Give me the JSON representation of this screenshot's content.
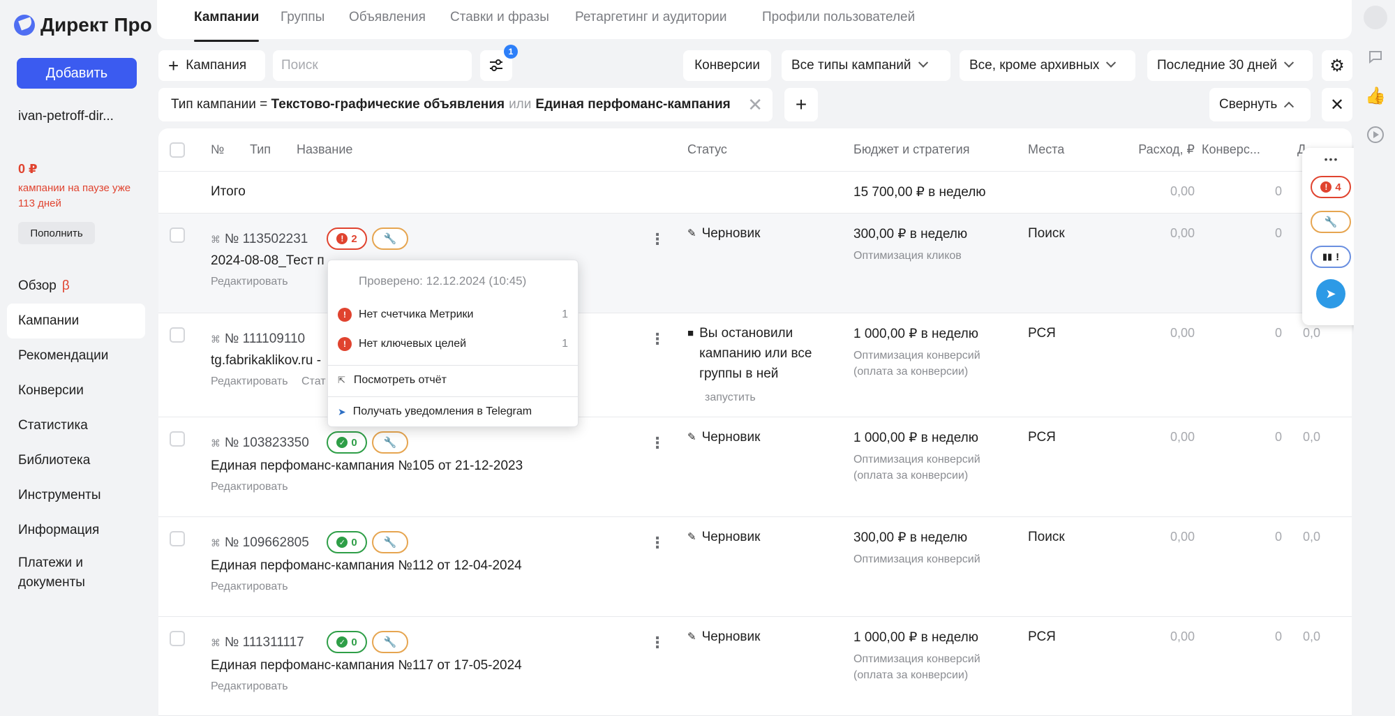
{
  "app": {
    "logo_text": "Директ Про"
  },
  "sidebar": {
    "add_label": "Добавить",
    "account": "ivan-petroff-dir...",
    "balance": "0 ₽",
    "pause_note": "кампании на паузе уже 113 дней",
    "topup_label": "Пополнить",
    "items": [
      {
        "label": "Обзор",
        "badge": "β"
      },
      {
        "label": "Кампании"
      },
      {
        "label": "Рекомендации"
      },
      {
        "label": "Конверсии"
      },
      {
        "label": "Статистика"
      },
      {
        "label": "Библиотека"
      },
      {
        "label": "Инструменты"
      },
      {
        "label": "Информация"
      },
      {
        "label": "Платежи и документы"
      }
    ]
  },
  "tabs": [
    {
      "label": "Кампании",
      "active": true
    },
    {
      "label": "Группы"
    },
    {
      "label": "Объявления"
    },
    {
      "label": "Ставки и фразы"
    },
    {
      "label": "Ретаргетинг и аудитории"
    },
    {
      "label": "Профили пользователей"
    }
  ],
  "toolbar": {
    "add_campaign": "Кампания",
    "search_placeholder": "Поиск",
    "filter_badge": "1",
    "conversions": "Конверсии",
    "campaign_types": "Все типы кампаний",
    "archive_filter": "Все, кроме архивных",
    "period": "Последние 30 дней"
  },
  "filter_chip": {
    "prefix": "Тип кампании = ",
    "value1": "Текстово-графические объявления",
    "or": "или",
    "value2": "Единая перфоманс-кампания"
  },
  "collapse_label": "Свернуть",
  "table": {
    "headers": {
      "no": "№",
      "type": "Тип",
      "name": "Название",
      "status": "Статус",
      "budget": "Бюджет и стратегия",
      "places": "Места",
      "spend": "Расход, ₽",
      "conv": "Конверс...",
      "extra": "Д"
    },
    "total": {
      "label": "Итого",
      "budget": "15 700,00 ₽ в неделю",
      "spend": "0,00",
      "conv": "0"
    },
    "rows": [
      {
        "id": "№ 113502231",
        "badge": "2",
        "badge_kind": "red",
        "name": "2024-08-08_Тест п",
        "edit": "Редактировать",
        "stats": "",
        "status": "Черновик",
        "status_icon": "pencil",
        "status_sub": "",
        "budget": "300,00 ₽ в неделю",
        "strategy": "Оптимизация кликов",
        "places": "Поиск",
        "spend": "0,00",
        "conv": "0",
        "extra": ""
      },
      {
        "id": "№ 111109110",
        "badge": "",
        "badge_kind": "none",
        "name": "tg.fabrikaklikov.ru -",
        "edit": "Редактировать",
        "stats": "Стат",
        "status": "Вы остановили кампанию или все группы в ней",
        "status_icon": "square",
        "status_sub": "запустить",
        "budget": "1 000,00 ₽ в неделю",
        "strategy": "Оптимизация конверсий (оплата за конверсии)",
        "places": "РСЯ",
        "spend": "0,00",
        "conv": "0",
        "extra": "0,0"
      },
      {
        "id": "№ 103823350",
        "badge": "0",
        "badge_kind": "green",
        "name": "Единая перфоманс-кампания №105 от 21-12-2023",
        "edit": "Редактировать",
        "stats": "",
        "status": "Черновик",
        "status_icon": "pencil",
        "status_sub": "",
        "budget": "1 000,00 ₽ в неделю",
        "strategy": "Оптимизация конверсий (оплата за конверсии)",
        "places": "РСЯ",
        "spend": "0,00",
        "conv": "0",
        "extra": "0,0"
      },
      {
        "id": "№ 109662805",
        "badge": "0",
        "badge_kind": "green",
        "name": "Единая перфоманс-кампания №112 от 12-04-2024",
        "edit": "Редактировать",
        "stats": "",
        "status": "Черновик",
        "status_icon": "pencil",
        "status_sub": "",
        "budget": "300,00 ₽ в неделю",
        "strategy": "Оптимизация конверсий",
        "places": "Поиск",
        "spend": "0,00",
        "conv": "0",
        "extra": "0,0"
      },
      {
        "id": "№ 111311117",
        "badge": "0",
        "badge_kind": "green",
        "name": "Единая перфоманс-кампания №117 от 17-05-2024",
        "edit": "Редактировать",
        "stats": "",
        "status": "Черновик",
        "status_icon": "pencil",
        "status_sub": "",
        "budget": "1 000,00 ₽ в неделю",
        "strategy": "Оптимизация конверсий (оплата за конверсии)",
        "places": "РСЯ",
        "spend": "0,00",
        "conv": "0",
        "extra": "0,0"
      }
    ]
  },
  "popover": {
    "checked": "Проверено: 12.12.2024 (10:45)",
    "issues": [
      {
        "label": "Нет счетчика Метрики",
        "count": "1"
      },
      {
        "label": "Нет ключевых целей",
        "count": "1"
      }
    ],
    "report": "Посмотреть отчёт",
    "telegram": "Получать уведомления в Telegram"
  },
  "widget": {
    "dots": "•••",
    "error_count": "4",
    "alert": "!"
  },
  "colors": {
    "accent": "#3b5bf0",
    "error": "#e0432f",
    "ok": "#2e9e47",
    "tool": "#e6a550",
    "telegram": "#2d9ae6"
  }
}
